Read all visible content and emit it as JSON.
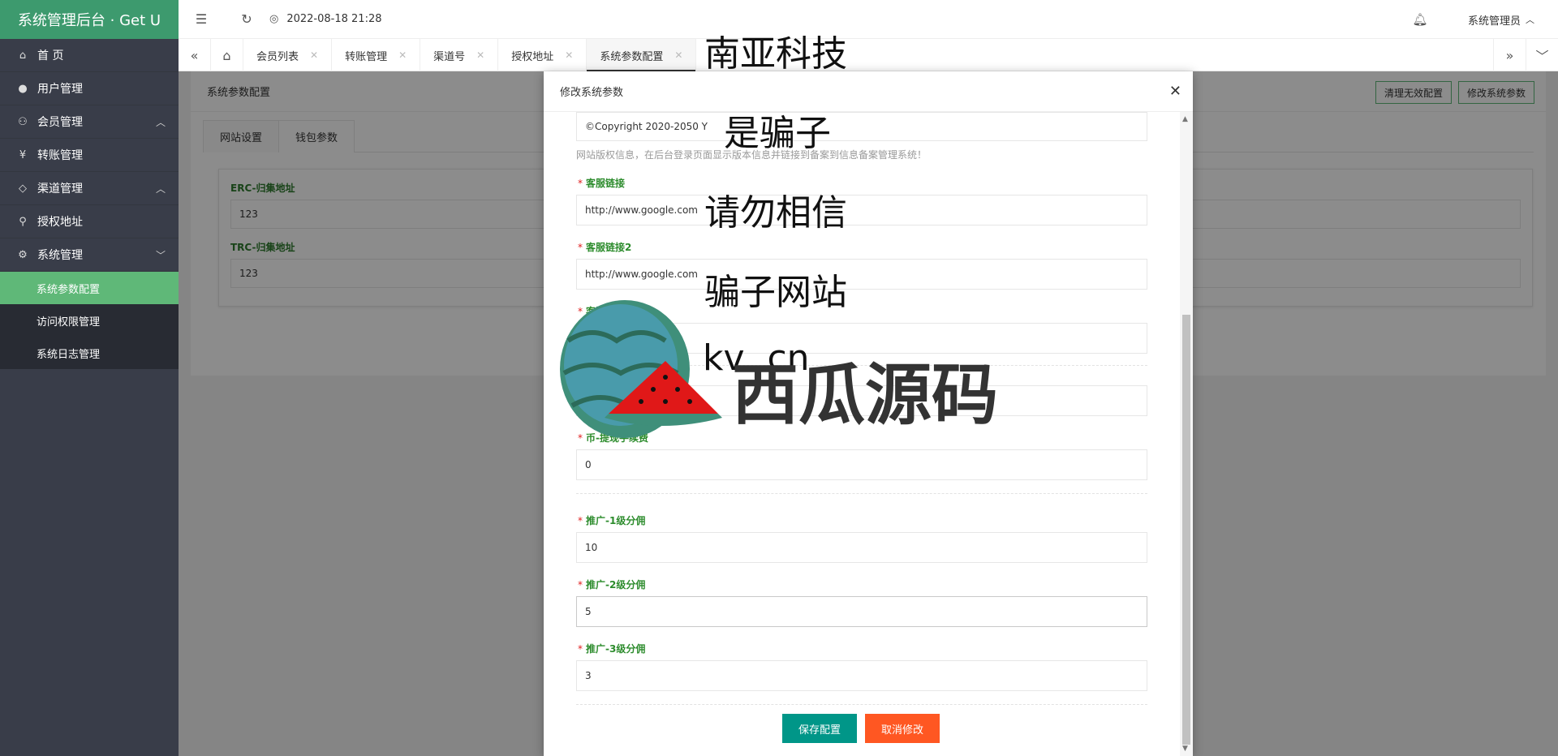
{
  "app": {
    "title": "系统管理后台 · Get U"
  },
  "header": {
    "datetime": "2022-08-18 21:28",
    "user": "系统管理员"
  },
  "sidebar": {
    "items": [
      {
        "label": "首 页",
        "icon": "home-icon"
      },
      {
        "label": "用户管理",
        "icon": "user-icon"
      },
      {
        "label": "会员管理",
        "icon": "member-icon",
        "arrow": "︿"
      },
      {
        "label": "转账管理",
        "icon": "yen-icon"
      },
      {
        "label": "渠道管理",
        "icon": "tag-icon",
        "arrow": "︿"
      },
      {
        "label": "授权地址",
        "icon": "pin-icon"
      },
      {
        "label": "系统管理",
        "icon": "gear-icon",
        "arrow": "﹀"
      }
    ],
    "submenu": [
      "系统参数配置",
      "访问权限管理",
      "系统日志管理"
    ]
  },
  "tabs": [
    "会员列表",
    "转账管理",
    "渠道号",
    "授权地址",
    "系统参数配置"
  ],
  "page": {
    "title": "系统参数配置",
    "btn_clean": "清理无效配置",
    "btn_edit": "修改系统参数",
    "inner_tabs": [
      "网站设置",
      "钱包参数"
    ],
    "fields": [
      {
        "label": "ERC-归集地址",
        "value": "123"
      },
      {
        "label": "TRC-归集地址",
        "value": "123"
      }
    ]
  },
  "modal": {
    "title": "修改系统参数",
    "copyright_value": "©Copyright 2020-2050 Y",
    "copyright_help": "网站版权信息，在后台登录页面显示版本信息并链接到备案到信息备案管理系统！",
    "fields": [
      {
        "label": "客服链接",
        "value": "http://www.google.com"
      },
      {
        "label": "客服链接2",
        "value": "http://www.google.com"
      },
      {
        "label": "客服",
        "value": ""
      },
      {
        "label": "",
        "value": ""
      },
      {
        "label": "币-提现手续费",
        "value": "0"
      },
      {
        "label": "推广-1级分佣",
        "value": "10"
      },
      {
        "label": "推广-2级分佣",
        "value": "5"
      },
      {
        "label": "推广-3级分佣",
        "value": "3"
      }
    ],
    "save": "保存配置",
    "cancel": "取消修改"
  },
  "watermark": {
    "lines": [
      "南亚科技",
      "是骗子",
      "请勿相信",
      "骗子网站",
      "kv   .cn"
    ],
    "brand": "西瓜源码"
  },
  "colors": {
    "sidebar": "#393d49",
    "logo": "#3d9a6e",
    "active": "#5fb878",
    "save": "#009688",
    "cancel": "#ff5722"
  }
}
